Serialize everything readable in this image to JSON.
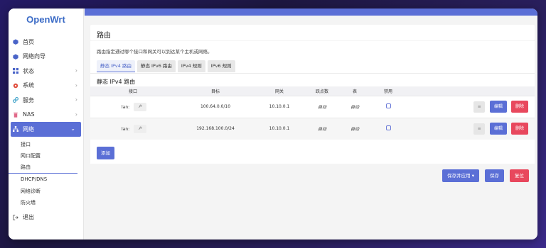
{
  "app": {
    "logo": "OpenWrt"
  },
  "sidebar": {
    "items": [
      {
        "label": "首页",
        "icon": "cube-icon",
        "has_chevron": false
      },
      {
        "label": "网络向导",
        "icon": "cube-icon",
        "has_chevron": false
      },
      {
        "label": "状态",
        "icon": "grid-icon",
        "has_chevron": true
      },
      {
        "label": "系统",
        "icon": "gear-icon",
        "has_chevron": true
      },
      {
        "label": "服务",
        "icon": "link-icon",
        "has_chevron": true
      },
      {
        "label": "NAS",
        "icon": "trash-icon",
        "has_chevron": true
      },
      {
        "label": "网络",
        "icon": "network-icon",
        "has_chevron": true,
        "active": true
      }
    ],
    "submenu": [
      "接口",
      "网口配置",
      "路由",
      "DHCP/DNS",
      "网络诊断",
      "防火墙"
    ],
    "current_submenu": "路由",
    "logout_label": "退出"
  },
  "page": {
    "title": "路由",
    "description": "路由指定通过哪个接口和网关可以到达某个主机或网络。",
    "tabs": [
      "静态 IPv4 路由",
      "静态 IPv6 路由",
      "IPv4 规则",
      "IPv6 规则"
    ],
    "active_tab": 0,
    "section_title": "静态 IPv4 路由"
  },
  "table": {
    "headers": [
      "接口",
      "目标",
      "网关",
      "跃点数",
      "表",
      "禁用"
    ],
    "rows": [
      {
        "iface": "lan:",
        "target": "100.64.0.0/10",
        "gateway": "10.10.0.1",
        "metric": "自动",
        "table": "自动",
        "disabled": false
      },
      {
        "iface": "lan:",
        "target": "192.168.100.0/24",
        "gateway": "10.10.0.1",
        "metric": "自动",
        "table": "自动",
        "disabled": false
      }
    ],
    "sort_glyph": "≡",
    "edit_label": "编辑",
    "delete_label": "删除",
    "add_label": "添加"
  },
  "footer": {
    "save_apply_label": "保存并应用 ▾",
    "save_label": "保存",
    "reset_label": "复位"
  },
  "colors": {
    "accent": "#5b6fd6",
    "danger": "#e8485d",
    "logo": "#3b6bc6"
  }
}
